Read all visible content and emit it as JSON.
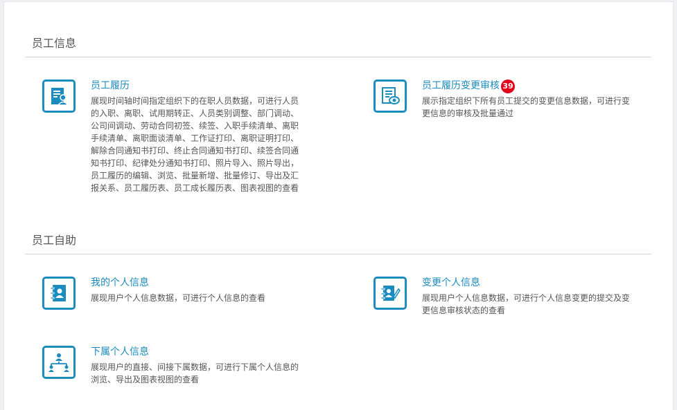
{
  "sections": [
    {
      "title": "员工信息",
      "cards": [
        {
          "title": "员工履历",
          "icon": "resume-person-icon",
          "desc": "展现时间轴时间指定组织下的在职人员数据，可进行人员的入职、离职、试用期转正、人员类别调整、部门调动、公司间调动、劳动合同初签、续签、入职手续清单、离职手续清单、离职面谈清单、工作证打印、离职证明打印、解除合同通知书打印、终止合同通知书打印、续签合同通知书打印、纪律处分通知书打印、照片导入、照片导出，员工履历的编辑、浏览、批量新增、批量修订、导出及汇报关系、员工履历表、员工成长履历表、图表视图的查看"
        },
        {
          "title": "员工履历变更审核",
          "badge": "39",
          "icon": "document-review-eye-icon",
          "desc": "展示指定组织下所有员工提交的变更信息数据，可进行变更信息的审核及批量通过"
        }
      ]
    },
    {
      "title": "员工自助",
      "cards": [
        {
          "title": "我的个人信息",
          "icon": "contact-book-icon",
          "desc": "展现用户个人信息数据，可进行个人信息的查看"
        },
        {
          "title": "变更个人信息",
          "icon": "contact-edit-icon",
          "desc": "展现用户个人信息数据，可进行个人信息变更的提交及变更信息审核状态的查看"
        },
        {
          "title": "下属个人信息",
          "icon": "org-chart-icon",
          "desc": "展现用户的直接、间接下属数据，可进行下属个人信息的浏览、导出及图表视图的查看"
        }
      ]
    }
  ],
  "colors": {
    "accent": "#1a8cc0",
    "badge": "#e2001a",
    "text": "#555555",
    "divider": "#cfd3d8"
  }
}
